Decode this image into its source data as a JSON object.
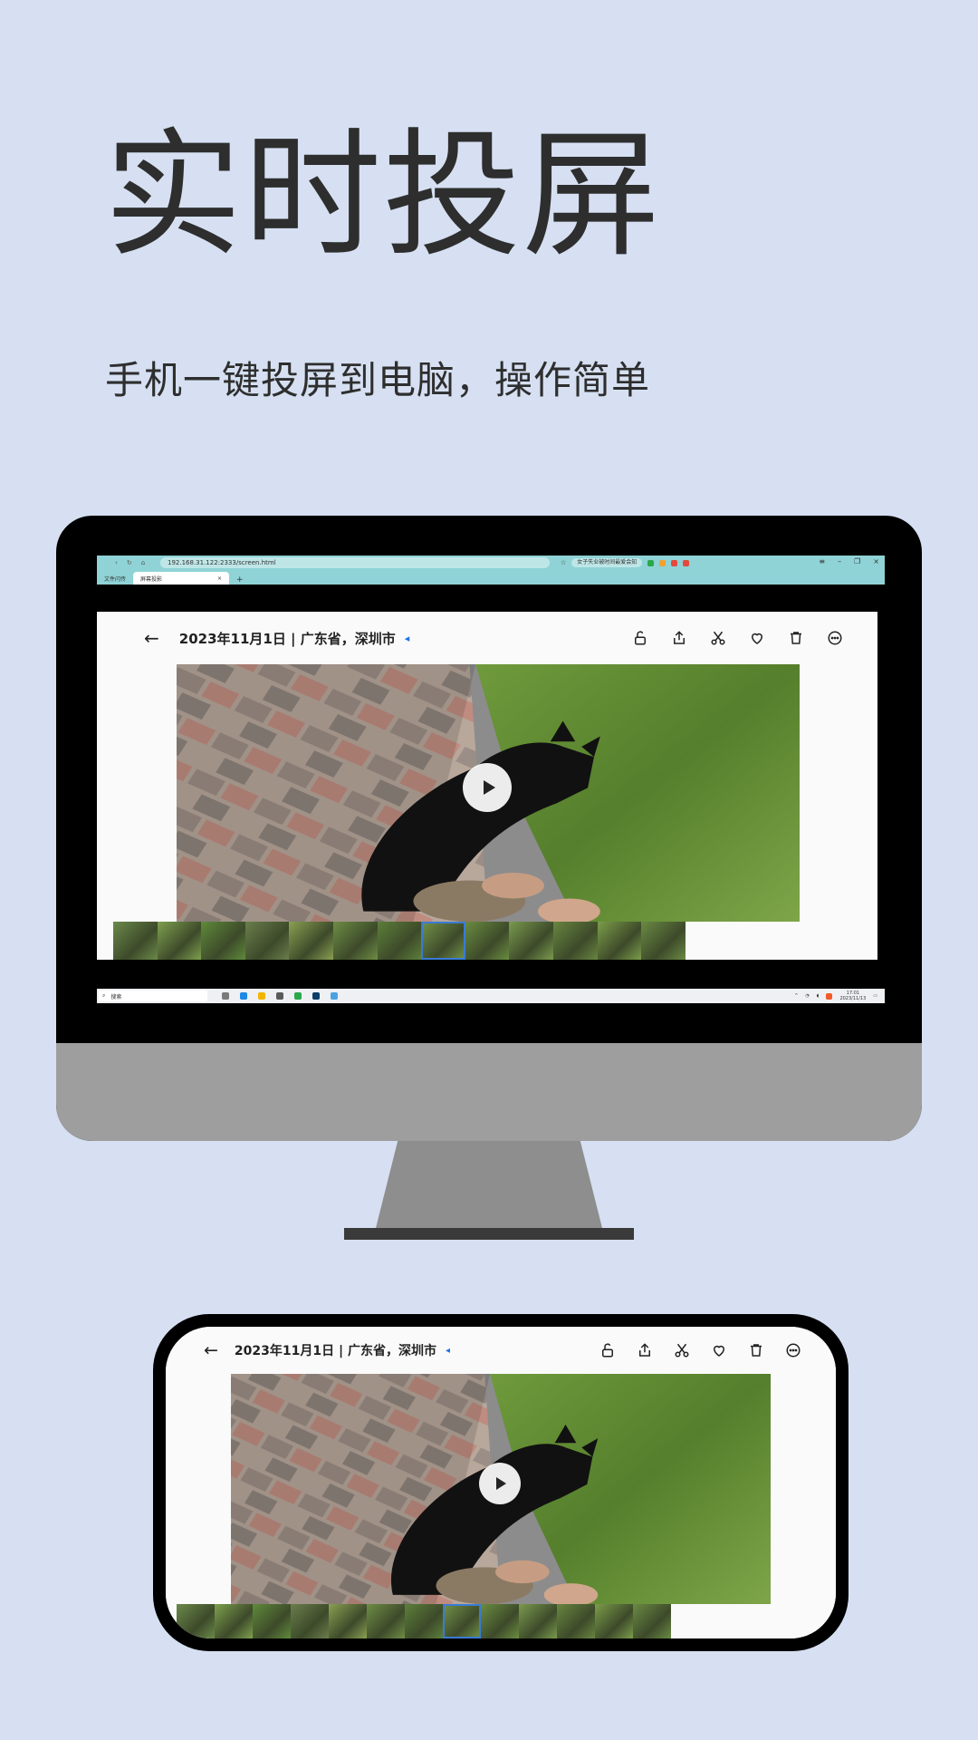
{
  "headline": "实时投屏",
  "subline": "手机一键投屏到电脑，操作简单",
  "browser": {
    "url": "192.168.31.122:2333/screen.html",
    "ext_chip": "女子失业被时间最爱会知",
    "tabs": [
      {
        "label": "文件闪传"
      },
      {
        "label": "屏幕投影"
      }
    ],
    "new_tab": "+"
  },
  "viewer": {
    "title": "2023年11月1日 | 广东省，深圳市",
    "location_marker": "◂"
  },
  "taskbar": {
    "search_label": "搜索",
    "time": "17:01",
    "date": "2023/11/13"
  },
  "colors": {
    "background": "#d6e0f2",
    "browser_bar": "#8fd3d6",
    "accent": "#1a73e8"
  }
}
